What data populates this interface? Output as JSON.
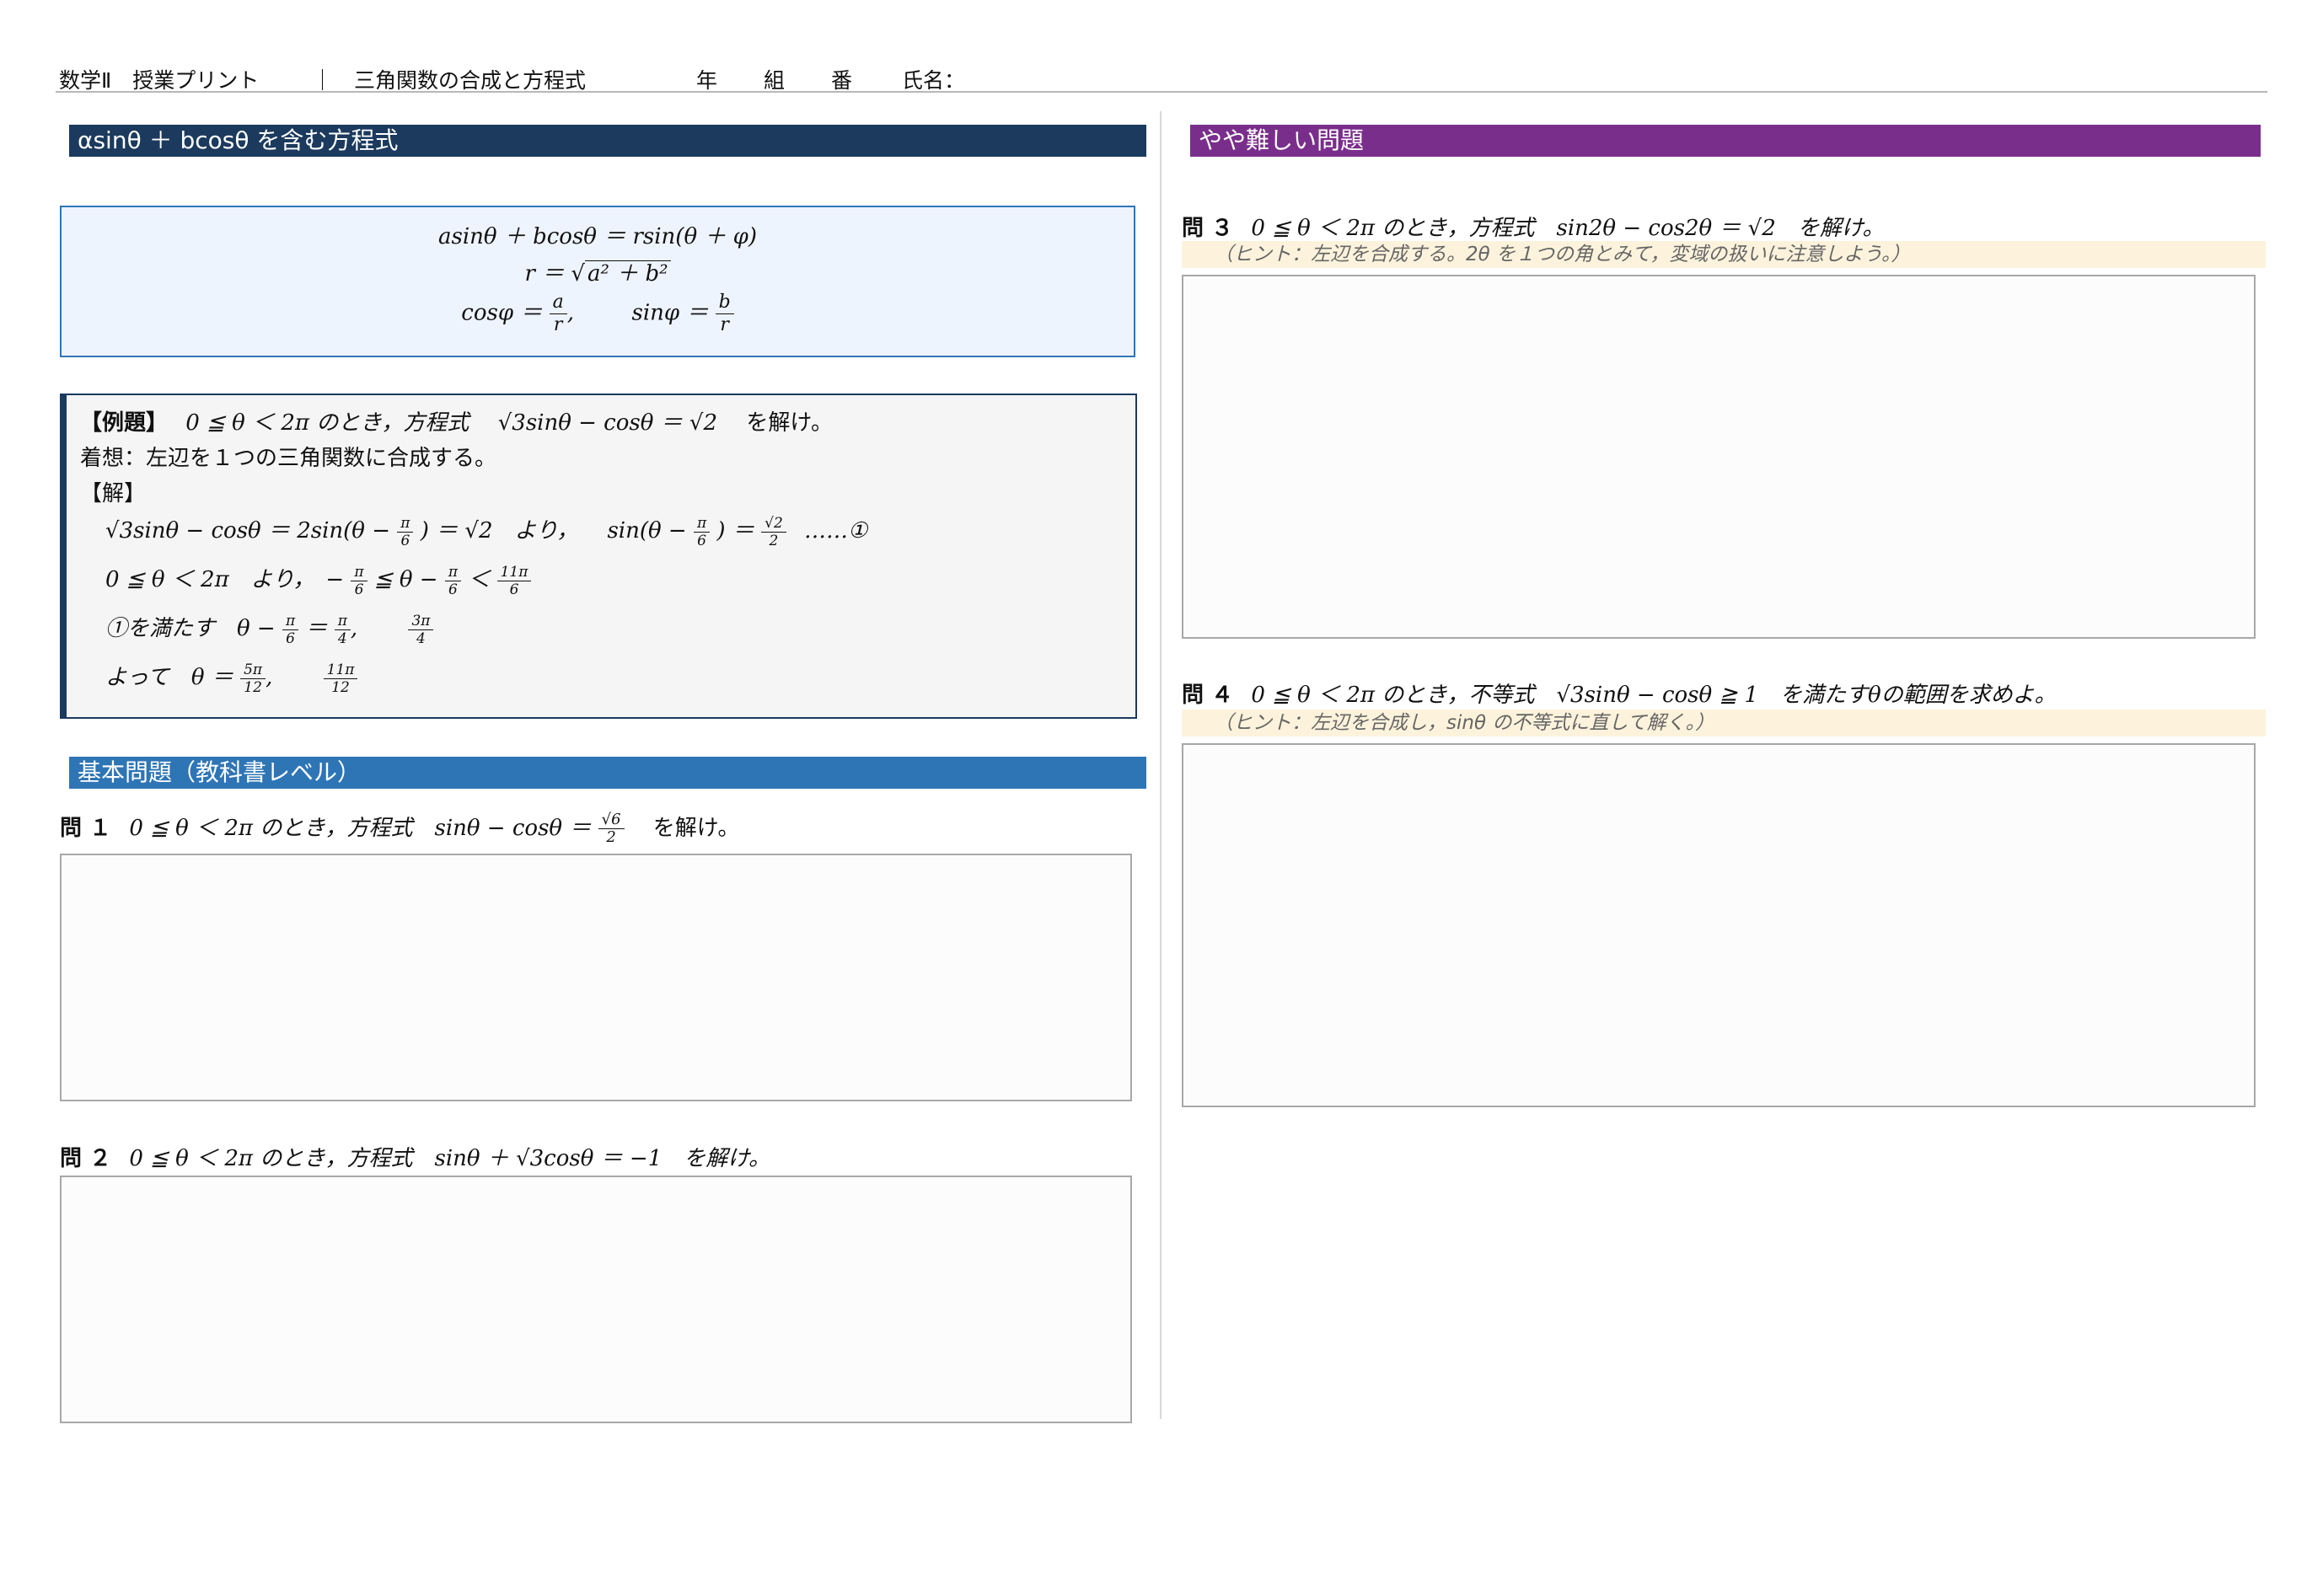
{
  "header": {
    "subject": "数学Ⅱ　授業プリント",
    "separator": "｜",
    "topic": "三角関数の合成と方程式",
    "year": "年",
    "class": "組",
    "number": "番",
    "name": "氏名："
  },
  "sections": {
    "main_title": "αsinθ ＋ bcosθ を含む方程式",
    "hard_title": "やや難しい問題",
    "basic_title": "基本問題（教科書レベル）"
  },
  "formula": {
    "line1": "asinθ ＋ bcosθ ＝ rsin(θ ＋ φ)",
    "line2_lhs": "r ＝ ",
    "line2_rad": "a² ＋ b²",
    "cos_lhs": "cosφ ＝ ",
    "sin_lhs": "sinφ ＝ ",
    "a": "a",
    "b": "b",
    "r": "r",
    "comma": ","
  },
  "example": {
    "label": "【例題】",
    "condition": "0 ≦ θ ＜ 2π のとき，方程式",
    "equation": "√3sinθ − cosθ ＝ √2",
    "instruction": "を解け。",
    "approach": "着想：左辺を１つの三角関数に合成する。",
    "solution_label": "【解】",
    "s1_part1": "√3sinθ − cosθ ＝ 2sin(θ −",
    "s1_part2": ") ＝ √2　より，",
    "s1_part3": "sin(θ −",
    "s1_part4": ") ＝",
    "s1_mark": "……①",
    "s2_part1": "0 ≦ θ ＜ 2π　より，　−",
    "s2_part2": "≦ θ −",
    "s2_part3": "＜",
    "s3_part1": "①を満たす　θ −",
    "s3_part2": "＝",
    "s3_part3": ",",
    "s4_part1": "よって　θ ＝",
    "s4_part2": ",",
    "pi": "π",
    "six": "6",
    "sqrt2": "√2",
    "two": "2",
    "eleven_pi": "11π",
    "four": "4",
    "three_pi": "3π",
    "five_pi": "5π",
    "twelve": "12"
  },
  "problems": {
    "q1_label": "問 １",
    "q1_text": "0 ≦ θ ＜ 2π のとき，方程式　sinθ − cosθ ＝",
    "q1_num": "√6",
    "q1_den": "2",
    "q1_end": "を解け。",
    "q2_label": "問 ２",
    "q2_text": "0 ≦ θ ＜ 2π のとき，方程式　sinθ ＋ √3cosθ ＝ −1　を解け。",
    "q3_label": "問 ３",
    "q3_text": "0 ≦ θ ＜ 2π のとき，方程式　sin2θ − cos2θ ＝ √2　を解け。",
    "q3_hint": "（ヒント：左辺を合成する。2θ を１つの角とみて，変域の扱いに注意しよう。）",
    "q4_label": "問 ４",
    "q4_text": "0 ≦ θ ＜ 2π のとき，不等式　√3sinθ − cosθ ≧ 1　を満たすθの範囲を求めよ。",
    "q4_hint": "（ヒント：左辺を合成し，sinθ の不等式に直して解く。）"
  }
}
